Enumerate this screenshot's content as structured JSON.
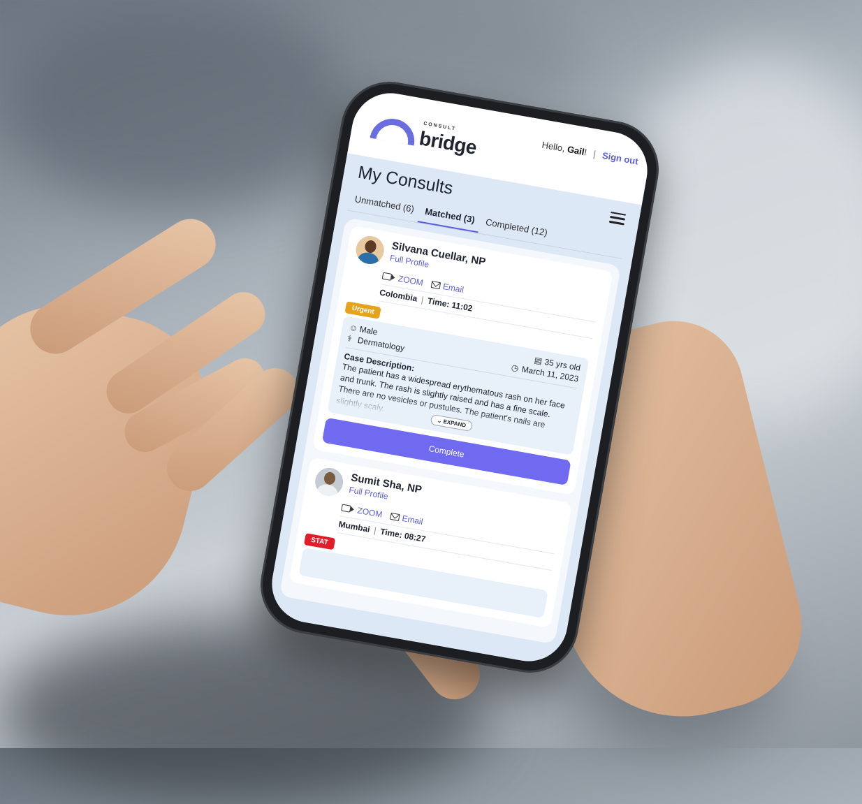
{
  "header": {
    "logo_small": "CONSULT",
    "logo_main": "bridge",
    "greeting_prefix": "Hello, ",
    "user_name": "Gail",
    "greeting_suffix": "!",
    "separator": "|",
    "sign_out": "Sign out"
  },
  "page": {
    "title": "My Consults",
    "menu_icon": "hamburger-menu-icon"
  },
  "tabs": [
    {
      "label": "Unmatched (6)",
      "active": false
    },
    {
      "label": "Matched (3)",
      "active": true
    },
    {
      "label": "Completed (12)",
      "active": false
    }
  ],
  "consults": [
    {
      "provider_name": "Silvana Cuellar, NP",
      "full_profile": "Full Profile",
      "zoom_label": "ZOOM",
      "email_label": "Email",
      "location": "Colombia",
      "time_label": "Time: 11:02",
      "priority": "Urgent",
      "gender": "Male",
      "age": "35 yrs old",
      "specialty": "Dermatology",
      "date": "March 11, 2023",
      "description_label": "Case Description:",
      "description": "The patient has a widespread erythematous rash on her face and trunk. The rash is slightly raised and has a fine scale. There are no vesicles or pustules. The patient's nails are slightly scaly.",
      "expand_label": "EXPAND",
      "complete_label": "Complete"
    },
    {
      "provider_name": "Sumit Sha, NP",
      "full_profile": "Full Profile",
      "zoom_label": "ZOOM",
      "email_label": "Email",
      "location": "Mumbai",
      "time_label": "Time: 08:27",
      "priority": "STAT"
    }
  ],
  "colors": {
    "accent": "#5b5fd6",
    "button": "#6f6af0",
    "urgent": "#e5a21a",
    "stat": "#e11d2a",
    "page_bg": "#dde8f7"
  }
}
